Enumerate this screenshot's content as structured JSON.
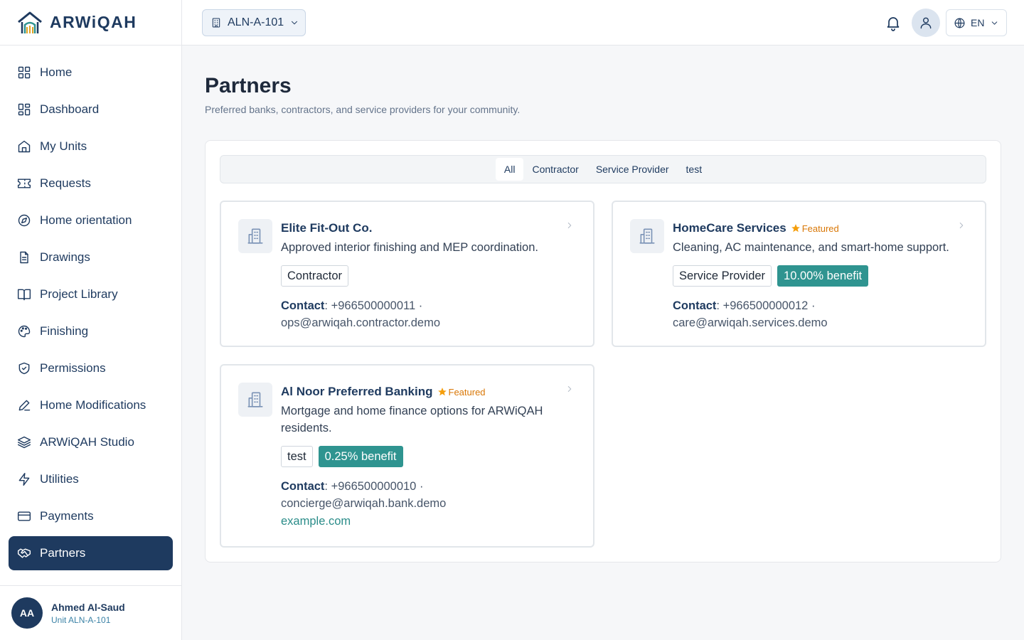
{
  "brand": {
    "name": "ARWiQAH"
  },
  "sidebar": {
    "items": [
      {
        "label": "Home",
        "icon": "grid-icon"
      },
      {
        "label": "Dashboard",
        "icon": "dashboard-icon"
      },
      {
        "label": "My Units",
        "icon": "house-icon"
      },
      {
        "label": "Requests",
        "icon": "ticket-icon"
      },
      {
        "label": "Home orientation",
        "icon": "compass-icon"
      },
      {
        "label": "Drawings",
        "icon": "document-icon"
      },
      {
        "label": "Project Library",
        "icon": "book-icon"
      },
      {
        "label": "Finishing",
        "icon": "palette-icon"
      },
      {
        "label": "Permissions",
        "icon": "shield-check-icon"
      },
      {
        "label": "Home Modifications",
        "icon": "pencil-icon"
      },
      {
        "label": "ARWiQAH Studio",
        "icon": "layers-icon"
      },
      {
        "label": "Utilities",
        "icon": "lightning-icon"
      },
      {
        "label": "Payments",
        "icon": "credit-card-icon"
      },
      {
        "label": "Partners",
        "icon": "handshake-icon",
        "active": true
      }
    ],
    "user": {
      "initials": "AA",
      "name": "Ahmed Al-Saud",
      "unit": "Unit ALN-A-101"
    }
  },
  "header": {
    "unit_selector": "ALN-A-101",
    "language": "EN"
  },
  "page": {
    "title": "Partners",
    "subtitle": "Preferred banks, contractors, and service providers for your community."
  },
  "tabs": [
    {
      "label": "All",
      "active": true
    },
    {
      "label": "Contractor"
    },
    {
      "label": "Service Provider"
    },
    {
      "label": "test"
    }
  ],
  "partners": [
    {
      "name": "Elite Fit-Out Co.",
      "featured": false,
      "description": "Approved interior finishing and MEP coordination.",
      "tag": "Contractor",
      "contact_label": "Contact",
      "phone": "+966500000011",
      "email": "ops@arwiqah.contractor.demo"
    },
    {
      "name": "HomeCare Services",
      "featured": true,
      "featured_label": "Featured",
      "description": "Cleaning, AC maintenance, and smart-home support.",
      "tag": "Service Provider",
      "benefit": "10.00% benefit",
      "contact_label": "Contact",
      "phone": "+966500000012",
      "email": "care@arwiqah.services.demo"
    },
    {
      "name": "Al Noor Preferred Banking",
      "featured": true,
      "featured_label": "Featured",
      "description": "Mortgage and home finance options for ARWiQAH residents.",
      "tag": "test",
      "benefit": "0.25% benefit",
      "contact_label": "Contact",
      "phone": "+966500000010",
      "email": "concierge@arwiqah.bank.demo",
      "website": "example.com"
    }
  ],
  "colors": {
    "primary": "#1e3a5f",
    "benefit": "#2f9490",
    "featured": "#d97706",
    "link": "#2a8c89"
  }
}
